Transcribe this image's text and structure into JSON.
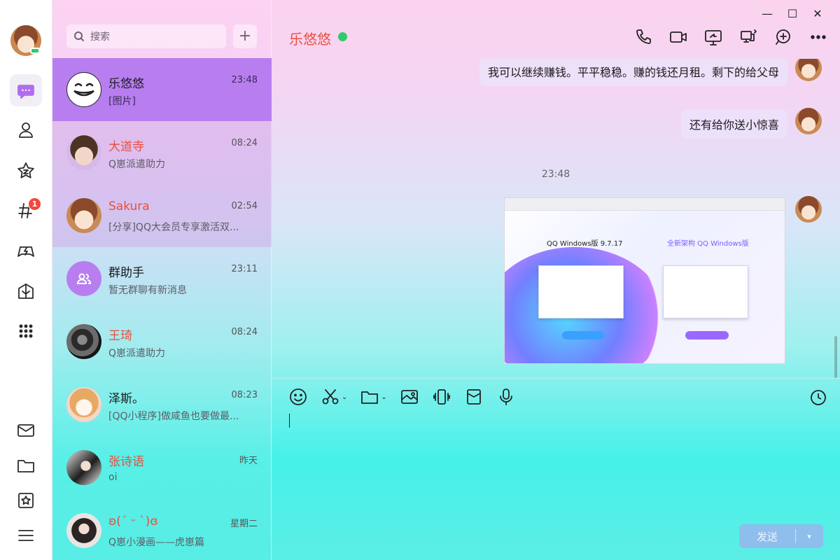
{
  "rail": {
    "items": [
      {
        "name": "messages",
        "icon": "chat-bubble-icon",
        "active": true
      },
      {
        "name": "contacts",
        "icon": "person-icon"
      },
      {
        "name": "favorites",
        "icon": "star-icon"
      },
      {
        "name": "channels",
        "icon": "hashtag-icon",
        "badge": "1"
      },
      {
        "name": "games",
        "icon": "gamepad-icon"
      },
      {
        "name": "apps",
        "icon": "gift-icon"
      },
      {
        "name": "more-apps",
        "icon": "grid-icon"
      },
      {
        "name": "mail",
        "icon": "mail-icon"
      },
      {
        "name": "files",
        "icon": "folder-icon"
      },
      {
        "name": "collections",
        "icon": "bookmark-icon"
      },
      {
        "name": "menu",
        "icon": "hamburger-icon"
      }
    ]
  },
  "search": {
    "placeholder": "搜索"
  },
  "conversations": [
    {
      "name": "乐悠悠",
      "time": "23:48",
      "preview": "[图片]",
      "selected": true,
      "red": false
    },
    {
      "name": "大道寺",
      "time": "08:24",
      "preview": "Q崽派遣助力",
      "red": true
    },
    {
      "name": "Sakura",
      "time": "02:54",
      "preview": "[分享]QQ大会员专享激活双...",
      "red": true
    },
    {
      "name": "群助手",
      "time": "23:11",
      "preview": "暂无群聊有新消息",
      "red": false
    },
    {
      "name": "王琦",
      "time": "08:24",
      "preview": "Q崽派遣助力",
      "red": true
    },
    {
      "name": "泽斯。",
      "time": "08:23",
      "preview": "[QQ小程序]做咸鱼也要做最...",
      "red": false
    },
    {
      "name": "张诗语",
      "time": "昨天",
      "preview": "oi",
      "red": true
    },
    {
      "name": "ʚ(ˊ ᵕ ˋ)ɞ",
      "time": "星期二",
      "preview": "Q崽小漫画——虎崽篇",
      "red": true
    }
  ],
  "chat": {
    "title": "乐悠悠",
    "messages": [
      {
        "text": "我可以继续赚钱。平平稳稳。赚的钱还月租。剩下的给父母"
      },
      {
        "text": "还有给你送小惊喜"
      }
    ],
    "timestamp": "23:48",
    "screenshot": {
      "title_left": "QQ Windows版 9.7.17",
      "title_right": "全新架构 QQ Windows版"
    }
  },
  "composer": {
    "send_label": "发送"
  },
  "colors": {
    "accent": "#b87ef0",
    "name_red": "#ea4f3e",
    "online": "#2fcb6b"
  }
}
